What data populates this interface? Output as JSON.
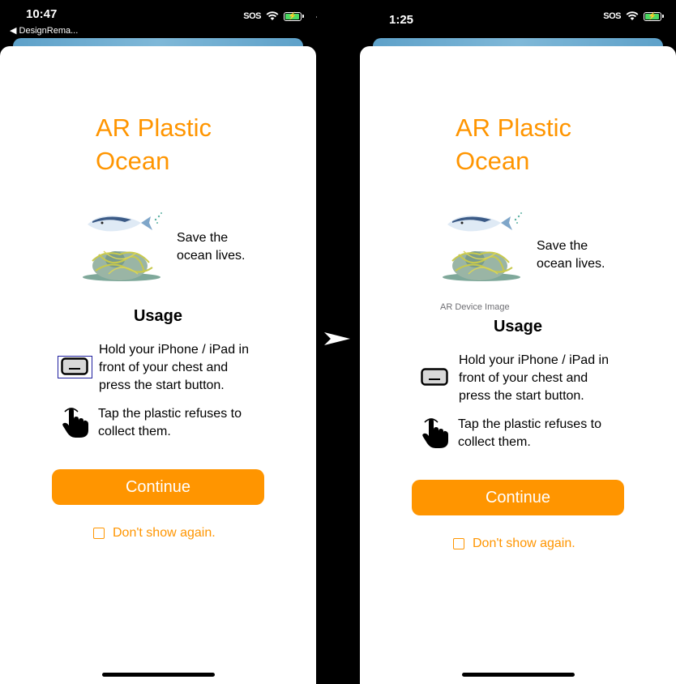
{
  "left": {
    "time": "10:47",
    "back_label": "◀ DesignRema...",
    "sos": "SOS",
    "title": "AR Plastic\nOcean",
    "save_text": "Save the\nocean lives.",
    "usage_title": "Usage",
    "hold_text": "Hold your iPhone / iPad in\nfront of your chest and\npress the start button.",
    "tap_text": "Tap the plastic refuses to\ncollect them.",
    "continue_label": "Continue",
    "dont_show_label": "Don't show again."
  },
  "right": {
    "time": "1:25",
    "sos": "SOS",
    "title": "AR Plastic\nOcean",
    "save_text": "Save the\nocean lives.",
    "ar_caption": "AR Device Image",
    "usage_title": "Usage",
    "hold_text": "Hold your iPhone / iPad in\nfront of your chest and\npress the start button.",
    "tap_text": "Tap the plastic refuses to\ncollect them.",
    "continue_label": "Continue",
    "dont_show_label": "Don't show again."
  },
  "icons": {
    "wifi": "wifi-icon",
    "battery": "battery-charging-icon",
    "device": "phone-landscape-icon",
    "hand": "hand-tap-icon",
    "fish": "fish-illustration",
    "turtle": "turtle-in-net-illustration",
    "arrow": "transition-arrow-icon"
  },
  "colors": {
    "accent": "#ff9500",
    "background": "#ffffff",
    "battery": "#4cd964"
  },
  "battery_level": 0.85
}
